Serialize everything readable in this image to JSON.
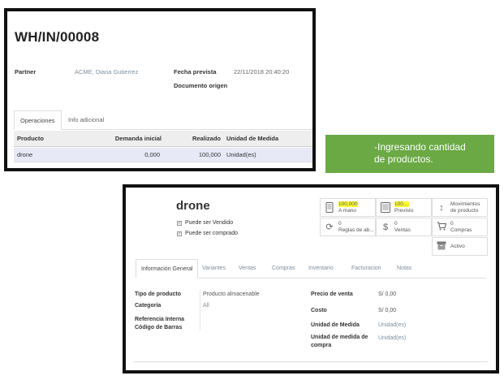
{
  "receipt": {
    "reference": "WH/IN/00008",
    "partner_label": "Partner",
    "partner_value": "ACME, Diana Gutierrez",
    "scheduled_label": "Fecha prevista",
    "scheduled_value": "22/11/2018 20:40:20",
    "source_label": "Documento origen",
    "tabs": [
      "Operaciones",
      "Info adicional"
    ],
    "columns": [
      "Producto",
      "Demanda inicial",
      "Realizado",
      "Unidad de Medida"
    ],
    "rows": [
      {
        "product": "drone",
        "initial_demand": "0,000",
        "done": "100,000",
        "uom": "Unidad(es)"
      }
    ]
  },
  "callout": {
    "line1": "-Ingresando cantidad",
    "line2": "de productos."
  },
  "product": {
    "name": "drone",
    "can_be_sold": "Puede ser Vendido",
    "can_be_purchased": "Puede ser comprado",
    "smart_buttons": {
      "on_hand": {
        "number": "100,000",
        "caption": "A mano",
        "icon": "mobile-icon"
      },
      "forecast": {
        "number": "100,...",
        "caption": "Previsto",
        "icon": "tablet-icon"
      },
      "moves": {
        "line1": "Movimientos",
        "line2": "de producto",
        "icon": "updown-arrow-icon"
      },
      "reordering": {
        "number": "0",
        "caption": "Reglas de ab...",
        "icon": "refresh-icon"
      },
      "sales": {
        "number": "0",
        "caption": "Ventas",
        "icon": "dollar-icon"
      },
      "purchases": {
        "number": "0",
        "caption": "Compras",
        "icon": "cart-icon"
      },
      "active": {
        "caption": "Activo",
        "icon": "archive-icon"
      }
    },
    "tabs": [
      "Información General",
      "Variantes",
      "Ventas",
      "Compras",
      "Inventario",
      "Facturacion",
      "Notas"
    ],
    "fields": {
      "type_label": "Tipo de producto",
      "type_value": "Producto almacenable",
      "category_label": "Categoría",
      "category_value": "All",
      "internal_ref_label": "Referencia Interna",
      "barcode_label": "Código de Barras",
      "sale_price_label": "Precio de venta",
      "sale_price_value": "S/ 0,00",
      "cost_label": "Costo",
      "cost_value": "S/ 0,00",
      "uom_label": "Unidad de Medida",
      "uom_value": "Unidad(es)",
      "purchase_uom_label_1": "Unidad de medida de",
      "purchase_uom_label_2": "compra",
      "purchase_uom_value": "Unidad(es)"
    }
  },
  "colors": {
    "callout_bg": "#6aa944",
    "highlight": "#ffff33",
    "selected_row": "#e8e9f7",
    "link": "#7c8f9f"
  }
}
